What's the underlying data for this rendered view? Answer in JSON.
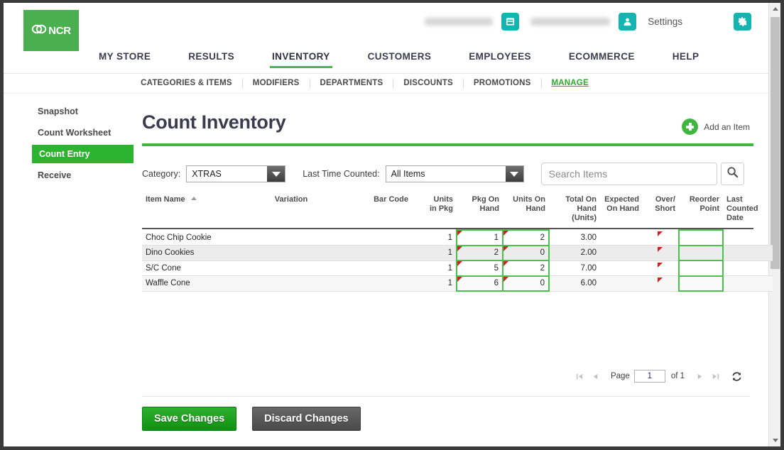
{
  "header": {
    "logo_text": "NCR",
    "logo_icon": "ncr-chainlink-logo",
    "store_name_redacted": "",
    "store_icon": "store-icon",
    "user_name_redacted": "",
    "user_icon": "person-icon",
    "settings_label": "Settings",
    "gear_icon": "gear-icon"
  },
  "mainnav": [
    {
      "label": "MY STORE",
      "active": false
    },
    {
      "label": "RESULTS",
      "active": false
    },
    {
      "label": "INVENTORY",
      "active": true
    },
    {
      "label": "CUSTOMERS",
      "active": false
    },
    {
      "label": "EMPLOYEES",
      "active": false
    },
    {
      "label": "ECOMMERCE",
      "active": false
    },
    {
      "label": "HELP",
      "active": false
    }
  ],
  "subnav": [
    {
      "label": "CATEGORIES & ITEMS",
      "active": false
    },
    {
      "label": "MODIFIERS",
      "active": false
    },
    {
      "label": "DEPARTMENTS",
      "active": false
    },
    {
      "label": "DISCOUNTS",
      "active": false
    },
    {
      "label": "PROMOTIONS",
      "active": false
    },
    {
      "label": "MANAGE",
      "active": true
    }
  ],
  "sidebar": {
    "items": [
      {
        "label": "Snapshot",
        "active": false
      },
      {
        "label": "Count Worksheet",
        "active": false
      },
      {
        "label": "Count Entry",
        "active": true
      },
      {
        "label": "Receive",
        "active": false
      }
    ]
  },
  "main": {
    "page_title": "Count Inventory",
    "add_item_label": "Add an Item",
    "add_item_icon": "plus-circle-icon"
  },
  "filters": {
    "category_label": "Category:",
    "category_value": "XTRAS",
    "last_counted_label": "Last Time Counted:",
    "last_counted_value": "All Items",
    "search_placeholder": "Search Items",
    "search_value": "",
    "search_icon": "magnifier-icon"
  },
  "table": {
    "columns": [
      "Item Name",
      "Variation",
      "Bar Code",
      "Units in Pkg",
      "Pkg On Hand",
      "Units On Hand",
      "Total On Hand (Units)",
      "Expected On Hand",
      "Over/ Short",
      "Reorder Point",
      "Last Counted Date"
    ],
    "columns_split": [
      {
        "line1": "Item Name",
        "line2": ""
      },
      {
        "line1": "Variation",
        "line2": ""
      },
      {
        "line1": "Bar Code",
        "line2": ""
      },
      {
        "line1": "Units",
        "line2": "in Pkg"
      },
      {
        "line1": "Pkg On",
        "line2": "Hand"
      },
      {
        "line1": "Units On",
        "line2": "Hand"
      },
      {
        "line1": "Total On",
        "line2": "Hand (Units)"
      },
      {
        "line1": "Expected",
        "line2": "On Hand"
      },
      {
        "line1": "Over/",
        "line2": "Short"
      },
      {
        "line1": "Reorder",
        "line2": "Point"
      },
      {
        "line1": "Last Counted",
        "line2": "Date"
      }
    ],
    "sort_column": "Item Name",
    "sort_direction": "asc",
    "rows": [
      {
        "item_name": "Choc Chip Cookie",
        "variation": "",
        "bar_code": "",
        "units_in_pkg": "1",
        "pkg_on_hand": "1",
        "units_on_hand": "2",
        "total_on_hand_units": "3.00",
        "expected_on_hand": "",
        "over_short": "",
        "reorder_point": "",
        "last_counted_date": ""
      },
      {
        "item_name": "Dino Cookies",
        "variation": "",
        "bar_code": "",
        "units_in_pkg": "1",
        "pkg_on_hand": "2",
        "units_on_hand": "0",
        "total_on_hand_units": "2.00",
        "expected_on_hand": "",
        "over_short": "",
        "reorder_point": "",
        "last_counted_date": ""
      },
      {
        "item_name": "S/C Cone",
        "variation": "",
        "bar_code": "",
        "units_in_pkg": "1",
        "pkg_on_hand": "5",
        "units_on_hand": "2",
        "total_on_hand_units": "7.00",
        "expected_on_hand": "",
        "over_short": "",
        "reorder_point": "",
        "last_counted_date": ""
      },
      {
        "item_name": "Waffle Cone",
        "variation": "",
        "bar_code": "",
        "units_in_pkg": "1",
        "pkg_on_hand": "6",
        "units_on_hand": "0",
        "total_on_hand_units": "6.00",
        "expected_on_hand": "",
        "over_short": "",
        "reorder_point": "",
        "last_counted_date": ""
      }
    ]
  },
  "pager": {
    "first_icon": "first-page-icon",
    "prev_icon": "prev-page-icon",
    "page_label": "Page",
    "page_value": "1",
    "of_label": "of 1",
    "next_icon": "next-page-icon",
    "last_icon": "last-page-icon",
    "refresh_icon": "refresh-icon"
  },
  "actions": {
    "save_label": "Save Changes",
    "discard_label": "Discard Changes"
  },
  "colors": {
    "brand_green": "#4caf4f",
    "accent_green": "#3fb63f",
    "active_green": "#2cb431",
    "teal": "#14b5b0",
    "cell_border_green": "#49c24b",
    "selected_cell_blue": "#bdd2ec",
    "red_marker": "#cc2222",
    "dark_text": "#3b3b4f"
  }
}
